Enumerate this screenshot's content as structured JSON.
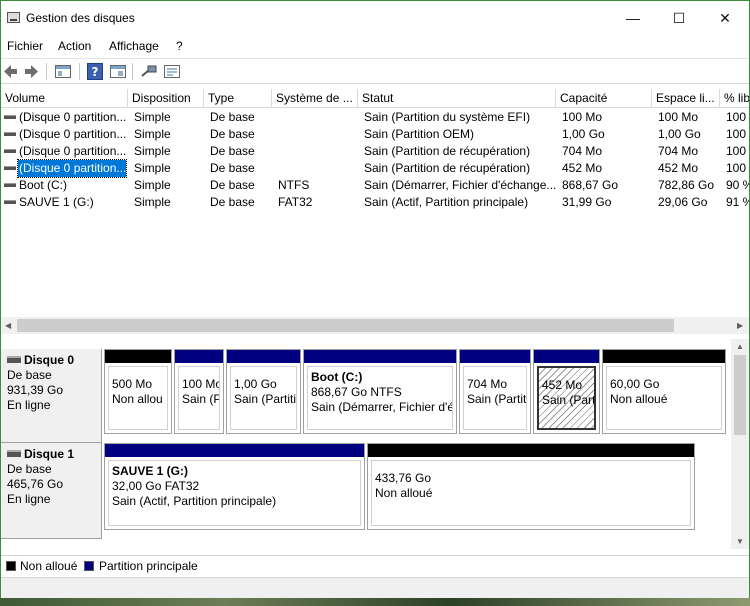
{
  "window": {
    "title": "Gestion des disques",
    "minimize": "—",
    "maximize": "☐",
    "close": "✕"
  },
  "menu": [
    "Fichier",
    "Action",
    "Affichage",
    "?"
  ],
  "columns": [
    "Volume",
    "Disposition",
    "Type",
    "Système de ...",
    "Statut",
    "Capacité",
    "Espace li...",
    "% lib"
  ],
  "volumes": [
    [
      "(Disque 0 partition...",
      "Simple",
      "De base",
      "",
      "Sain (Partition du système EFI)",
      "100 Mo",
      "100 Mo",
      "100 %"
    ],
    [
      "(Disque 0 partition...",
      "Simple",
      "De base",
      "",
      "Sain (Partition OEM)",
      "1,00 Go",
      "1,00 Go",
      "100 %"
    ],
    [
      "(Disque 0 partition...",
      "Simple",
      "De base",
      "",
      "Sain (Partition de récupération)",
      "704 Mo",
      "704 Mo",
      "100 %"
    ],
    [
      "(Disque 0 partition...",
      "Simple",
      "De base",
      "",
      "Sain (Partition de récupération)",
      "452 Mo",
      "452 Mo",
      "100 %"
    ],
    [
      "Boot (C:)",
      "Simple",
      "De base",
      "NTFS",
      "Sain (Démarrer, Fichier d'échange...",
      "868,67 Go",
      "782,86 Go",
      "90 %"
    ],
    [
      "SAUVE 1 (G:)",
      "Simple",
      "De base",
      "FAT32",
      "Sain (Actif, Partition principale)",
      "31,99 Go",
      "29,06 Go",
      "91 %"
    ]
  ],
  "selected_row": 3,
  "disks": [
    {
      "name": "Disque 0",
      "type": "De base",
      "size": "931,39 Go",
      "status": "En ligne",
      "partitions": [
        {
          "title": "",
          "line1": "500 Mo",
          "line2": "Non allou",
          "kind": "unallocated"
        },
        {
          "title": "",
          "line1": "100 Mo",
          "line2": "Sain (P",
          "kind": "primary"
        },
        {
          "title": "",
          "line1": "1,00 Go",
          "line2": "Sain (Partitio",
          "kind": "primary"
        },
        {
          "title": "Boot  (C:)",
          "line1": "868,67 Go NTFS",
          "line2": "Sain (Démarrer, Fichier d'é",
          "kind": "primary"
        },
        {
          "title": "",
          "line1": "704 Mo",
          "line2": "Sain (Partit",
          "kind": "primary"
        },
        {
          "title": "",
          "line1": "452 Mo",
          "line2": "Sain (Parti",
          "kind": "primary",
          "selected": true
        },
        {
          "title": "",
          "line1": "60,00 Go",
          "line2": "Non alloué",
          "kind": "unallocated"
        }
      ]
    },
    {
      "name": "Disque 1",
      "type": "De base",
      "size": "465,76 Go",
      "status": "En ligne",
      "partitions": [
        {
          "title": "SAUVE 1  (G:)",
          "line1": "32,00 Go FAT32",
          "line2": "Sain (Actif, Partition principale)",
          "kind": "primary"
        },
        {
          "title": "",
          "line1": "433,76 Go",
          "line2": "Non alloué",
          "kind": "unallocated"
        }
      ]
    }
  ],
  "legend": {
    "unallocated": "Non alloué",
    "primary": "Partition principale"
  },
  "colors": {
    "primary": "#000080",
    "unallocated": "#000000",
    "selection": "#0078d7"
  },
  "toolbar_icons": [
    "back-arrow-icon",
    "forward-arrow-icon",
    "console-tree-icon",
    "help-icon",
    "properties-icon",
    "connect-icon",
    "list-view-icon"
  ]
}
